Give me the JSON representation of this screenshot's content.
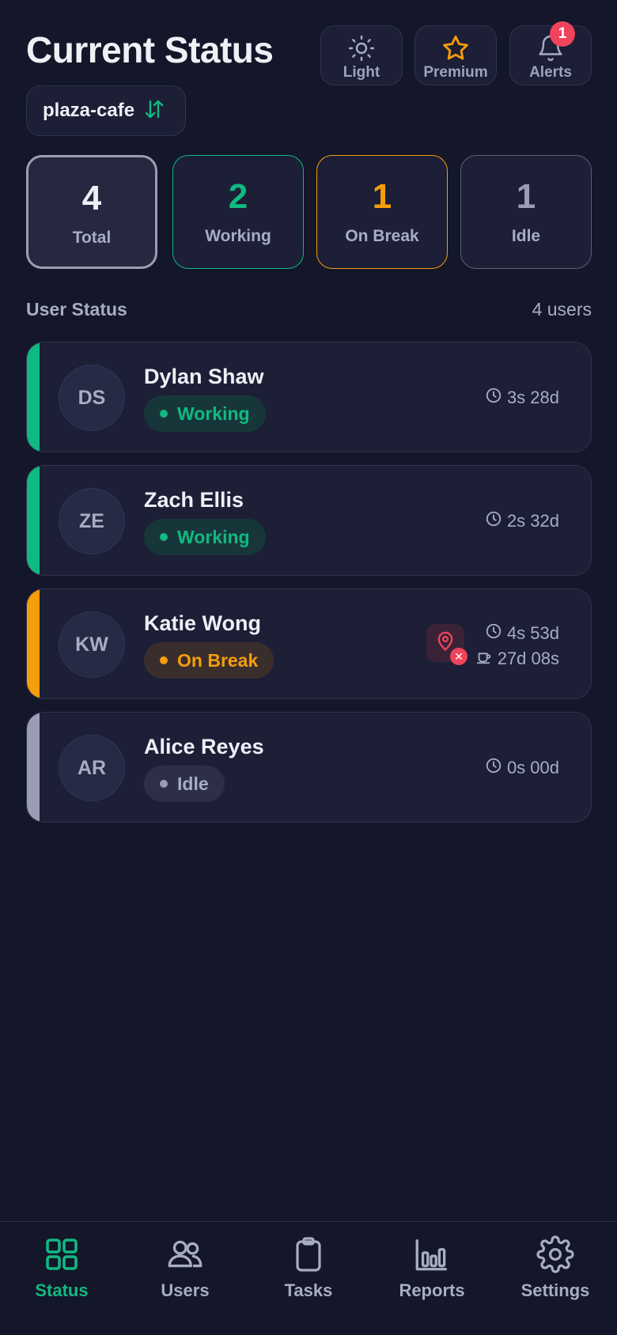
{
  "header": {
    "title": "Current Status",
    "buttons": [
      {
        "label": "Light",
        "icon": "sun-icon"
      },
      {
        "label": "Premium",
        "icon": "star-icon"
      },
      {
        "label": "Alerts",
        "icon": "bell-icon",
        "badge": "1"
      }
    ]
  },
  "location": {
    "name": "plaza-cafe",
    "icon": "swap-arrows-icon"
  },
  "summary": {
    "total": {
      "value": "4",
      "label": "Total"
    },
    "working": {
      "value": "2",
      "label": "Working"
    },
    "on_break": {
      "value": "1",
      "label": "On Break"
    },
    "idle": {
      "value": "1",
      "label": "Idle"
    }
  },
  "section": {
    "title": "User Status",
    "count": "4 users"
  },
  "users": [
    {
      "initials": "DS",
      "name": "Dylan Shaw",
      "status": "Working",
      "time": "3s 28d"
    },
    {
      "initials": "ZE",
      "name": "Zach Ellis",
      "status": "Working",
      "time": "2s 32d"
    },
    {
      "initials": "KW",
      "name": "Katie Wong",
      "status": "On Break",
      "time": "4s 53d",
      "break_time": "27d 08s",
      "location_warning": true
    },
    {
      "initials": "AR",
      "name": "Alice Reyes",
      "status": "Idle",
      "time": "0s 00d"
    }
  ],
  "nav": [
    {
      "label": "Status",
      "icon": "grid-icon",
      "active": true
    },
    {
      "label": "Users",
      "icon": "users-icon"
    },
    {
      "label": "Tasks",
      "icon": "clipboard-icon"
    },
    {
      "label": "Reports",
      "icon": "bar-chart-icon"
    },
    {
      "label": "Settings",
      "icon": "gear-icon"
    }
  ],
  "colors": {
    "background": "#141629",
    "working": "#10b981",
    "on_break": "#f59e0b",
    "idle": "#9a9db3",
    "alert": "#f0435c"
  }
}
